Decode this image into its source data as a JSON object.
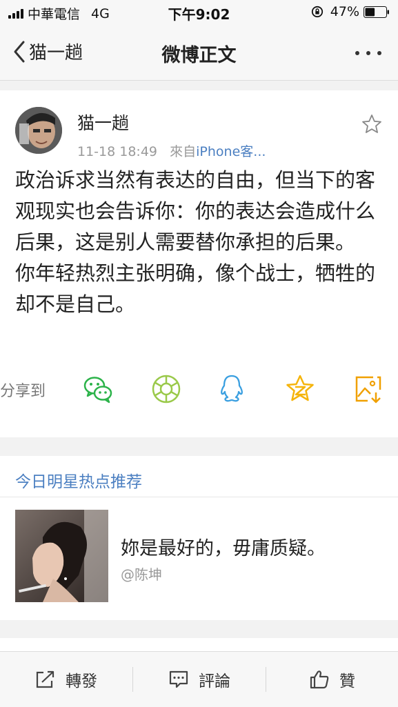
{
  "status_bar": {
    "carrier": "中華電信",
    "network": "4G",
    "time": "下午9:02",
    "battery": "47%",
    "battery_level": 0.47
  },
  "nav": {
    "back_label": "猫一趟",
    "title": "微博正文",
    "more_icon": "more-dots-icon"
  },
  "post": {
    "author": "猫一趟",
    "timestamp": "11-18 18:49",
    "source_prefix": "來自",
    "source": "iPhone客...",
    "body_lines": [
      "政治诉求当然有表达的自由，但当下的客观现实也会告诉你：你的表达会造成什么后果，这是别人需要替你承担的后果。",
      "你年轻热烈主张明确，像个战士，牺牲的却不是自己。"
    ],
    "share_label": "分享到",
    "share_icons": [
      "wechat-icon",
      "moments-icon",
      "qq-icon",
      "qzone-icon",
      "save-image-icon"
    ]
  },
  "recommendation": {
    "title": "今日明星热点推荐",
    "text": "妳是最好的，毋庸质疑。",
    "author": "@陈坤"
  },
  "toolbar": {
    "repost_label": "轉發",
    "comment_label": "評論",
    "like_label": "贊"
  },
  "colors": {
    "link_blue": "#4b7fc1",
    "wechat_green": "#2cb34a",
    "moments_green": "#9ac94a",
    "qq_blue": "#3a9fe0",
    "qzone_yellow": "#f5b40b",
    "save_orange": "#f0a000"
  }
}
